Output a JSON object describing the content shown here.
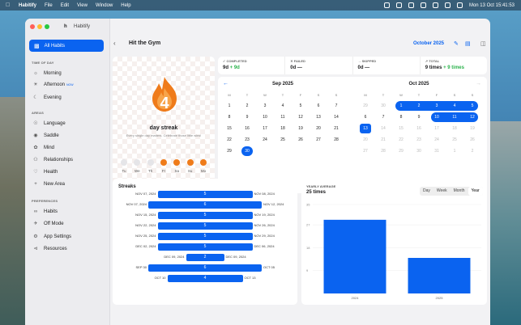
{
  "menubar": {
    "app": "Habitify",
    "menus": [
      "File",
      "Edit",
      "View",
      "Window",
      "Help"
    ],
    "datetime": "Mon 13 Oct 15:41:53"
  },
  "window": {
    "title": "Habitify"
  },
  "sidebar": {
    "all_habits": "All Habits",
    "time_of_day_header": "TIME OF DAY",
    "time_items": [
      {
        "label": "Morning",
        "icon": "sunrise-icon"
      },
      {
        "label": "Afternoon",
        "icon": "sun-icon",
        "badge": "NOW"
      },
      {
        "label": "Evening",
        "icon": "moon-icon"
      }
    ],
    "areas_header": "AREAS",
    "area_items": [
      {
        "label": "Language",
        "icon": "globe-icon"
      },
      {
        "label": "Saddle",
        "icon": "saddle-icon"
      },
      {
        "label": "Mind",
        "icon": "brain-icon"
      },
      {
        "label": "Relationships",
        "icon": "people-icon"
      },
      {
        "label": "Health",
        "icon": "heart-icon"
      },
      {
        "label": "New Area",
        "icon": "plus-icon"
      }
    ],
    "preferences_header": "PREFERENCES",
    "pref_items": [
      {
        "label": "Habits",
        "icon": "infinity-icon"
      },
      {
        "label": "Off Mode",
        "icon": "airplane-icon"
      },
      {
        "label": "App Settings",
        "icon": "gear-icon"
      },
      {
        "label": "Resources",
        "icon": "share-icon"
      }
    ]
  },
  "header": {
    "title": "Hit the Gym",
    "month": "October 2025"
  },
  "streak": {
    "count": "4",
    "label": "day streak",
    "tagline": "Every single day matters. Celebrate those little wins!",
    "days": [
      {
        "d": "Tu",
        "on": false
      },
      {
        "d": "We",
        "on": false
      },
      {
        "d": "Th",
        "on": false
      },
      {
        "d": "Fr",
        "on": true
      },
      {
        "d": "Sa",
        "on": true
      },
      {
        "d": "Su",
        "on": true
      },
      {
        "d": "Mo",
        "on": true
      }
    ]
  },
  "stats": [
    {
      "label": "COMPLETED",
      "value": "9d",
      "delta": "+ 9d",
      "icon": "check-icon"
    },
    {
      "label": "FAILED",
      "value": "0d —",
      "delta": "",
      "icon": "x-icon"
    },
    {
      "label": "SKIPPED",
      "value": "0d —",
      "delta": "",
      "icon": "skip-icon"
    },
    {
      "label": "TOTAL",
      "value": "9 times",
      "delta": "+ 9 times",
      "icon": "trend-icon"
    }
  ],
  "calendar": {
    "weekdays": [
      "M",
      "T",
      "W",
      "T",
      "F",
      "S",
      "S"
    ],
    "sep": {
      "title": "Sep 2025",
      "weeks": [
        [
          "1",
          "2",
          "3",
          "4",
          "5",
          "6",
          "7"
        ],
        [
          "8",
          "9",
          "10",
          "11",
          "12",
          "13",
          "14"
        ],
        [
          "15",
          "16",
          "17",
          "18",
          "19",
          "20",
          "21"
        ],
        [
          "22",
          "23",
          "24",
          "25",
          "26",
          "27",
          "28"
        ],
        [
          "29",
          "30",
          "",
          "",
          "",
          "",
          ""
        ]
      ],
      "completed": [
        "30"
      ]
    },
    "oct": {
      "title": "Oct 2025",
      "weeks": [
        [
          "29",
          "30",
          "1",
          "2",
          "3",
          "4",
          "5"
        ],
        [
          "6",
          "7",
          "8",
          "9",
          "10",
          "11",
          "12"
        ],
        [
          "13",
          "14",
          "15",
          "16",
          "17",
          "18",
          "19"
        ],
        [
          "20",
          "21",
          "22",
          "23",
          "24",
          "25",
          "26"
        ],
        [
          "27",
          "28",
          "29",
          "30",
          "31",
          "1",
          "2"
        ]
      ],
      "completed": [
        "1",
        "2",
        "3",
        "4",
        "5",
        "10",
        "11",
        "12",
        "13"
      ]
    }
  },
  "streaks": {
    "title": "Streaks",
    "rows": [
      {
        "start": "NOV 07, 2024",
        "end": "NOV 08, 2024",
        "count": "5"
      },
      {
        "start": "NOV 07, 2024",
        "end": "NOV 12, 2024",
        "count": "6"
      },
      {
        "start": "NOV 15, 2024",
        "end": "NOV 19, 2024",
        "count": "5"
      },
      {
        "start": "NOV 22, 2024",
        "end": "NOV 26, 2024",
        "count": "5"
      },
      {
        "start": "NOV 25, 2024",
        "end": "NOV 29, 2024",
        "count": "5"
      },
      {
        "start": "DEC 02, 2024",
        "end": "DEC 06, 2024",
        "count": "5"
      },
      {
        "start": "DEC 09, 2024",
        "end": "DEC 09, 2024",
        "count": "2"
      },
      {
        "start": "SEP 30",
        "end": "OCT 05",
        "count": "6"
      },
      {
        "start": "OCT 10",
        "end": "OCT 13",
        "count": "4"
      }
    ]
  },
  "yearly": {
    "label": "YEARLY AVERAGE",
    "value": "25 times",
    "tabs": [
      "Day",
      "Week",
      "Month",
      "Year"
    ],
    "active_tab": "Year"
  },
  "chart_data": {
    "type": "bar",
    "categories": [
      "2024",
      "2025"
    ],
    "values": [
      29,
      14
    ],
    "ylim": [
      0,
      35
    ],
    "yticks": [
      "35",
      "27",
      "18",
      "9"
    ],
    "color": "#0a63f0"
  },
  "colors": {
    "accent": "#0a63f0",
    "flame": "#ef7b1a",
    "success": "#2bb24c"
  }
}
